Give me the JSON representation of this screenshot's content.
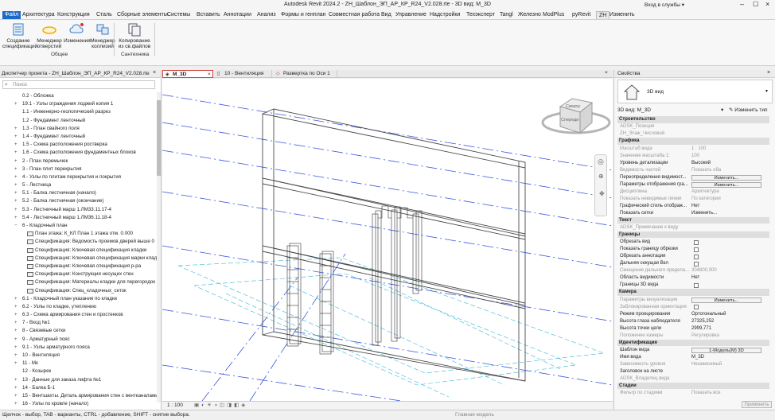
{
  "title": "Autodesk Revit 2024.2 - ZH_Шаблон_ЭП_АР_КР_R24_V2.028.rte - 3D вид: M_3D",
  "user": "Вход в службы",
  "menu": [
    "Файл",
    "Архитектура",
    "Конструкция",
    "Сталь",
    "Сборные элементы",
    "Системы",
    "Вставить",
    "Аннотации",
    "Анализ",
    "Формы и генплан",
    "Совместная работа",
    "Вид",
    "Управление",
    "Надстройки",
    "Техэксперт",
    "Tangl",
    "Железно",
    "ModPlus",
    "pyRevit",
    "ZH",
    "Изменить"
  ],
  "ribbon": {
    "buttons": [
      "Создание\nспецификаций",
      "Менеджер\nотверстий",
      "Изменения",
      "Менеджер\nколлизий",
      "Копирование\nиз св.файлов"
    ],
    "groups": [
      "Общее",
      "Сантехника"
    ]
  },
  "browser": {
    "title": "Диспетчер проекта - ZH_Шаблон_ЭП_АР_КР_R24_V2.028.rte",
    "search_placeholder": "Поиск",
    "items": [
      {
        "exp": "",
        "label": "0.2 - Обложка"
      },
      {
        "exp": "+",
        "label": "19.1 - Узлы ограждения лоджий копия 1"
      },
      {
        "exp": "",
        "label": "1.1 - Инженерно-геологический разрез"
      },
      {
        "exp": "",
        "label": "1.2 - Фундамент ленточный"
      },
      {
        "exp": "+",
        "label": "1.3 - План свайного поля"
      },
      {
        "exp": "+",
        "label": "1.4 - Фундамент ленточный"
      },
      {
        "exp": "+",
        "label": "1.5 - Схема расположения ростверка"
      },
      {
        "exp": "+",
        "label": "1.6 - Схема расположения фундаментных блоков"
      },
      {
        "exp": "+",
        "label": "2 - План перемычек"
      },
      {
        "exp": "+",
        "label": "3 - План плит перекрытия"
      },
      {
        "exp": "+",
        "label": "4 - Узлы по плитам перекрытия и покрытия"
      },
      {
        "exp": "+",
        "label": "5 - Лестница"
      },
      {
        "exp": "+",
        "label": "5.1 - Балка лестничная (начало)"
      },
      {
        "exp": "+",
        "label": "5.2 - Балка лестничная (окончание)"
      },
      {
        "exp": "+",
        "label": "5.3 - Лестничный марш 1.ЛМ33.11.17-4"
      },
      {
        "exp": "+",
        "label": "5.4 - Лестничный марш 1.ЛМ36.11.18-4"
      },
      {
        "exp": "−",
        "label": "6 - Кладочный план"
      },
      {
        "exp": "",
        "label": "План этажа: К_КЛ План 1 этажа отм. 0.000",
        "child": true
      },
      {
        "exp": "",
        "label": "Спецификация: Ведомость проемов дверей выше 0",
        "child": true
      },
      {
        "exp": "",
        "label": "Спецификация: Ключевая спецификация кладки",
        "child": true
      },
      {
        "exp": "",
        "label": "Спецификация: Ключевая спецификация марки клад",
        "child": true
      },
      {
        "exp": "",
        "label": "Спецификация: Ключевая спецификация р-ра",
        "child": true
      },
      {
        "exp": "",
        "label": "Спецификация: Конструкция несущих стен",
        "child": true
      },
      {
        "exp": "",
        "label": "Спецификация: Материалы кладки для перегородок",
        "child": true
      },
      {
        "exp": "",
        "label": "Спецификация: Спец_кладочных_сеток",
        "child": true
      },
      {
        "exp": "+",
        "label": "6.1 - Кладочный план указания по кладке"
      },
      {
        "exp": "+",
        "label": "6.2 - Узлы по кладке, утеплению"
      },
      {
        "exp": "+",
        "label": "6.3 - Схема армирования стен и простенков"
      },
      {
        "exp": "+",
        "label": "7 - Вход №1"
      },
      {
        "exp": "+",
        "label": "8 - Связевые сетки"
      },
      {
        "exp": "+",
        "label": "9 - Арматурный пояс"
      },
      {
        "exp": "+",
        "label": "9.1 - Узлы арматурного пояса"
      },
      {
        "exp": "+",
        "label": "10 - Вентиляция"
      },
      {
        "exp": "+",
        "label": "11 - Мк"
      },
      {
        "exp": "",
        "label": "12 - Козырек"
      },
      {
        "exp": "+",
        "label": "13 - Данные для заказа лифта №1"
      },
      {
        "exp": "+",
        "label": "14 - Балка Б-1"
      },
      {
        "exp": "+",
        "label": "15 - Вентшахты. Деталь армирования стен с вентканалами"
      },
      {
        "exp": "+",
        "label": "16 - Узлы по кровле (начало)"
      }
    ]
  },
  "doc_tabs": [
    "M_3D",
    "10 - Вентиляция",
    "Развертка по Оси 1"
  ],
  "view_cube": {
    "top": "Сверху",
    "front": "Спереди"
  },
  "viewbar": {
    "scale": "1 : 100"
  },
  "properties": {
    "title": "Свойства",
    "type_name": "3D вид",
    "selector": "3D вид: M_3D",
    "edit_type": "Изменить тип",
    "rows": [
      {
        "kind": "sec",
        "k": "Строительство"
      },
      {
        "kind": "dim",
        "k": "ADSK_Позиция",
        "v": ""
      },
      {
        "kind": "dim",
        "k": "ZH_Этаж_Числовой",
        "v": ""
      },
      {
        "kind": "sec",
        "k": "Графика"
      },
      {
        "kind": "dim",
        "k": "Масштаб вида",
        "v": "1 : 100"
      },
      {
        "kind": "dim",
        "k": "Значение масштаба  1:",
        "v": "100"
      },
      {
        "kind": "row",
        "k": "Уровень детализации",
        "v": "Высокий"
      },
      {
        "kind": "dim",
        "k": "Видимость частей",
        "v": "Показать оба"
      },
      {
        "kind": "btn",
        "k": "Переопределения видимост...",
        "v": "Изменить..."
      },
      {
        "kind": "btn",
        "k": "Параметры отображения гра...",
        "v": "Изменить..."
      },
      {
        "kind": "dim",
        "k": "Дисциплина",
        "v": "Архитектура"
      },
      {
        "kind": "dim",
        "k": "Показать невидимые линии",
        "v": "По категории"
      },
      {
        "kind": "row",
        "k": "Графический стиль отображ...",
        "v": "Нет"
      },
      {
        "kind": "row",
        "k": "Показать сетки",
        "v": "Изменить..."
      },
      {
        "kind": "sec",
        "k": "Текст"
      },
      {
        "kind": "dim",
        "k": "ADSK_Примечание к виду",
        "v": ""
      },
      {
        "kind": "sec",
        "k": "Границы"
      },
      {
        "kind": "cb",
        "k": "Обрезать вид"
      },
      {
        "kind": "cb",
        "k": "Показать границу обрезки"
      },
      {
        "kind": "cb",
        "k": "Обрезать аннотации"
      },
      {
        "kind": "cb",
        "k": "Дальняя секущая Вкл"
      },
      {
        "kind": "dim",
        "k": "Смещение дальнего предела...",
        "v": "304800,000"
      },
      {
        "kind": "row",
        "k": "Область видимости",
        "v": "Нет"
      },
      {
        "kind": "cb",
        "k": "Границы 3D вида"
      },
      {
        "kind": "sec",
        "k": "Камера"
      },
      {
        "kind": "dimbtn",
        "k": "Параметры визуализации",
        "v": "Изменить..."
      },
      {
        "kind": "cb",
        "k": "Заблокированная ориентация",
        "dim": true
      },
      {
        "kind": "row",
        "k": "Режим проецирования",
        "v": "Ортогональный"
      },
      {
        "kind": "row",
        "k": "Высота глаза наблюдателя",
        "v": "27325,252"
      },
      {
        "kind": "row",
        "k": "Высота точки цели",
        "v": "2999,771"
      },
      {
        "kind": "dim",
        "k": "Положение камеры",
        "v": "Регулировка"
      },
      {
        "kind": "sec",
        "k": "Идентификация"
      },
      {
        "kind": "btn",
        "k": "Шаблон вида",
        "v": "1-Модель(М) 3D"
      },
      {
        "kind": "row",
        "k": "Имя вида",
        "v": "M_3D"
      },
      {
        "kind": "dim",
        "k": "Зависимость уровня",
        "v": "Независимый"
      },
      {
        "kind": "row",
        "k": "Заголовок на листе",
        "v": ""
      },
      {
        "kind": "dim",
        "k": "ADSK_Владелец вида",
        "v": ""
      },
      {
        "kind": "sec",
        "k": "Стадии"
      },
      {
        "kind": "dim",
        "k": "Фильтр по стадиям",
        "v": "Показать все"
      }
    ],
    "apply": "Применить"
  },
  "status": "Щелчок - выбор, TAB - варианты, CTRL - добавление, SHIFT - снятие выбора.",
  "status_model": "Главная модель",
  "colors": {
    "file_tab": "#1b6ac9",
    "active_tab_border": "#d04040",
    "model": "#4a4a4a",
    "grid": "#3a55e0"
  }
}
